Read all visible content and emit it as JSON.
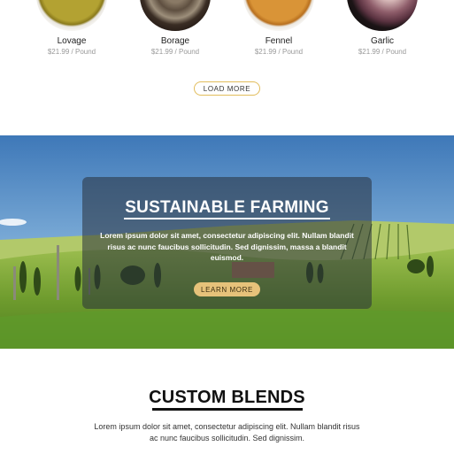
{
  "products": [
    {
      "name": "Lovage",
      "price": "$21.99 / Pound",
      "color": "#a59428"
    },
    {
      "name": "Borage",
      "price": "$21.99 / Pound",
      "color": "#6b5b4a"
    },
    {
      "name": "Fennel",
      "price": "$21.99 / Pound",
      "color": "#d38a2c"
    },
    {
      "name": "Garlic",
      "price": "$21.99 / Pound",
      "color": "#8a6270"
    }
  ],
  "load_more_label": "LOAD MORE",
  "hero": {
    "title": "SUSTAINABLE FARMING",
    "text": "Lorem ipsum dolor sit amet, consectetur adipiscing elit. Nullam blandit risus ac nunc faucibus sollicitudin. Sed dignissim, massa a blandit euismod.",
    "button_label": "LEARN MORE"
  },
  "blends": {
    "title": "CUSTOM BLENDS",
    "text": "Lorem ipsum dolor sit amet, consectetur adipiscing elit. Nullam blandit risus ac nunc faucibus sollicitudin. Sed dignissim."
  },
  "colors": {
    "accent": "#e2bd5c",
    "button_fill": "#e6c27a"
  }
}
